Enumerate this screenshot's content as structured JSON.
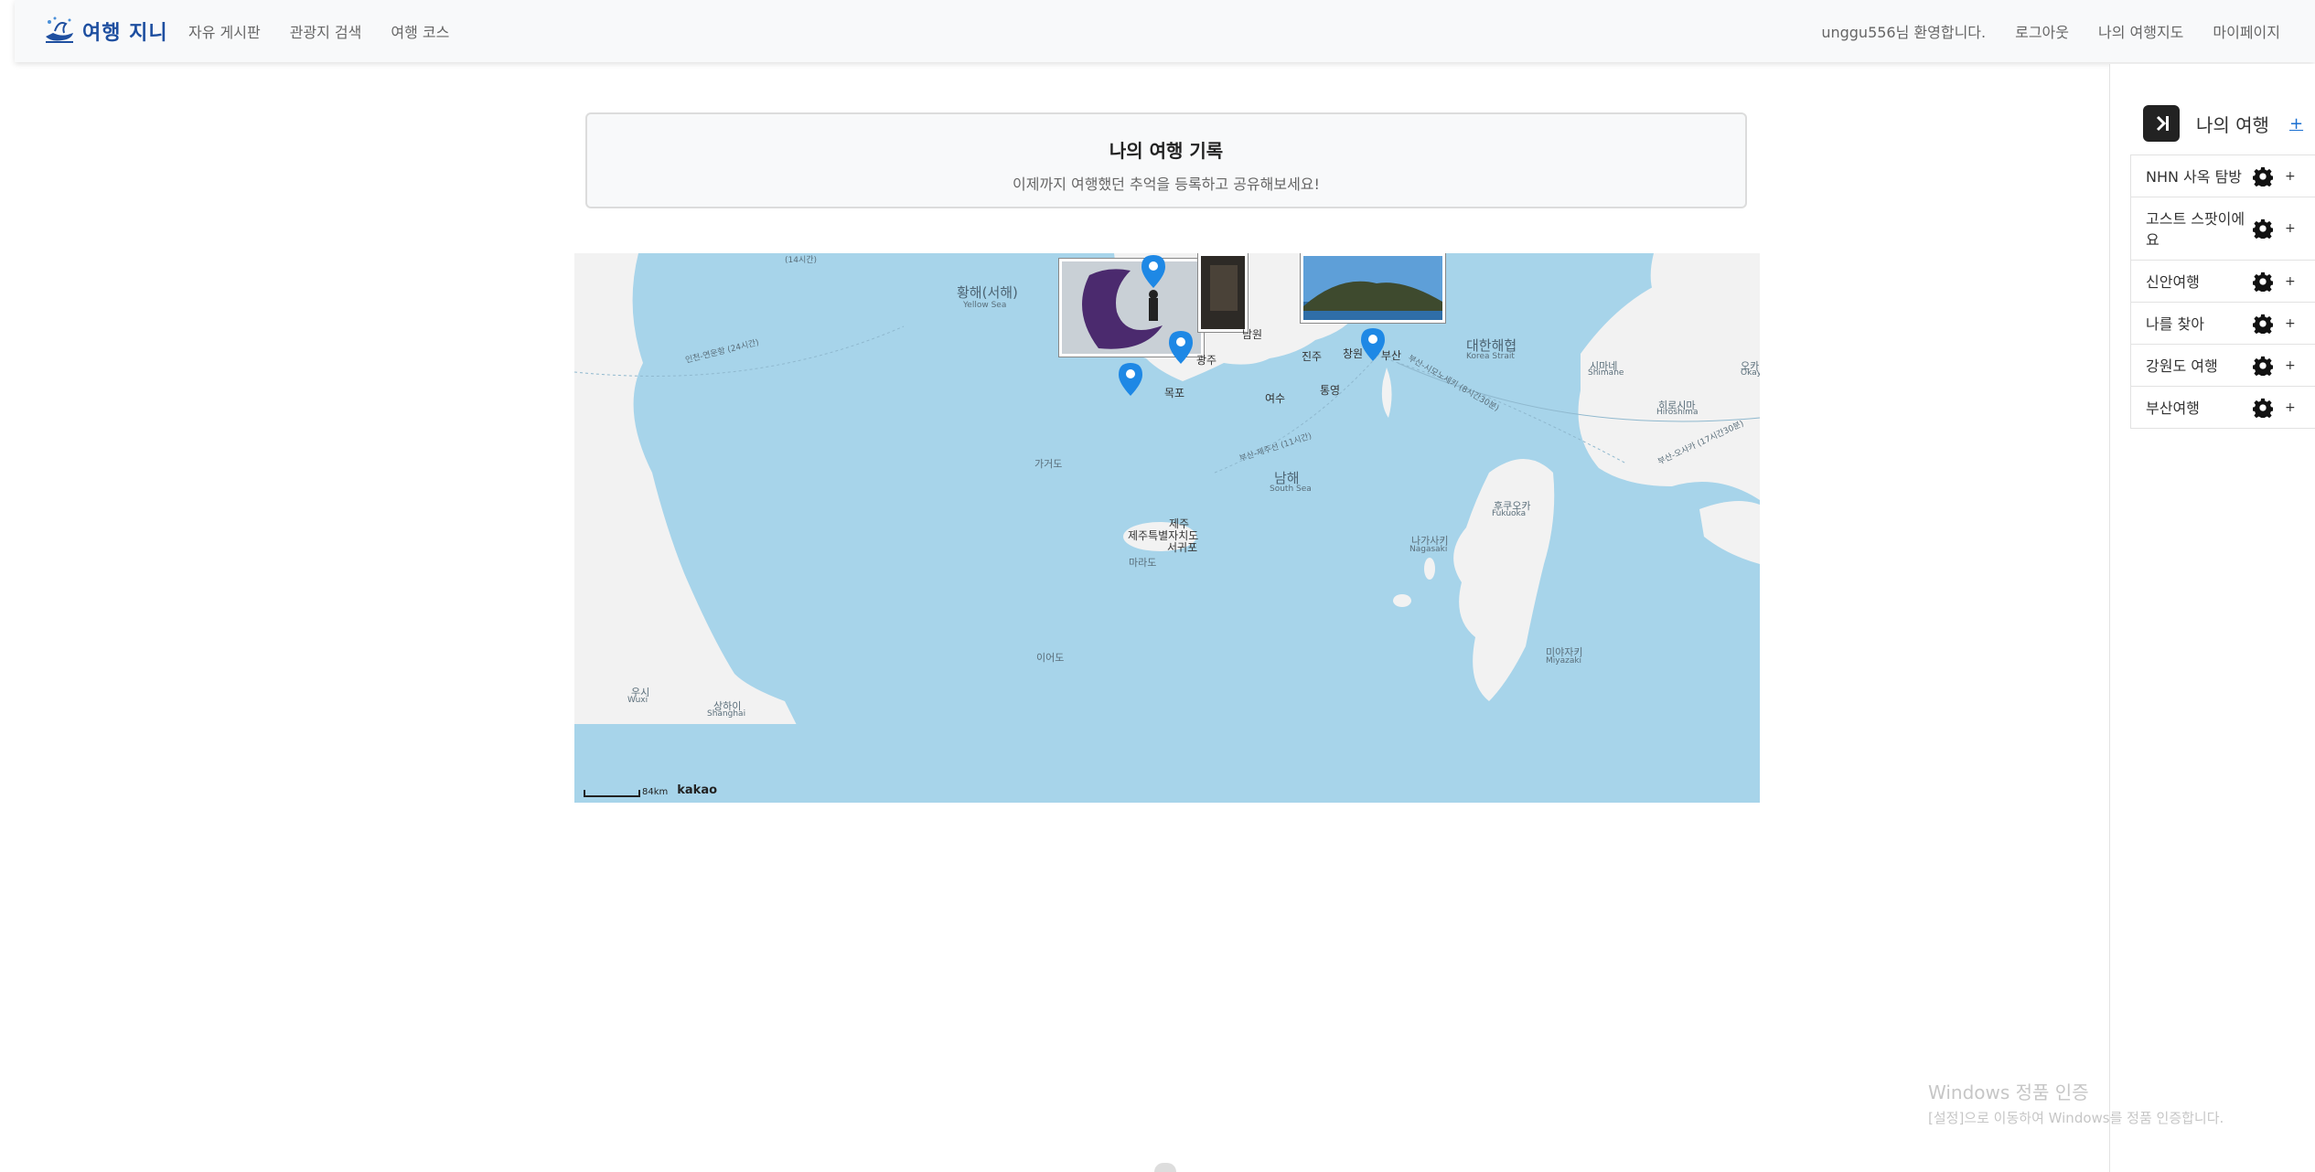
{
  "brand": {
    "logo_text": "여행 지니"
  },
  "nav": {
    "left": [
      "자유 게시판",
      "관광지 검색",
      "여행 코스"
    ],
    "welcome": "unggu556님 환영합니다.",
    "right": [
      "로그아웃",
      "나의 여행지도",
      "마이페이지"
    ]
  },
  "header": {
    "title": "나의 여행 기록",
    "subtitle": "이제까지 여행했던 추억을 등록하고 공유해보세요!"
  },
  "map": {
    "labels": {
      "yellow_sea_ko": "황해(서해)",
      "yellow_sea_en": "Yellow Sea",
      "korea_strait_ko": "대한해협",
      "korea_strait_en": "Korea Strait",
      "south_sea_ko": "남해",
      "south_sea_en": "South Sea",
      "gwangju": "광주",
      "busan": "부산",
      "mokpo": "목포",
      "jinju": "진주",
      "changwon": "창원",
      "yeosu": "여수",
      "tongyeong": "통영",
      "namwon": "남원",
      "gageodo": "가거도",
      "jeju": "제주",
      "jeju_province": "제주특별자치도",
      "seogwipo": "서귀포",
      "marado": "마라도",
      "ieodo": "이어도",
      "fukuoka_ko": "후쿠오카",
      "fukuoka_en": "Fukuoka",
      "nagasaki_ko": "나가사키",
      "nagasaki_en": "Nagasaki",
      "miyazaki_ko": "미야자키",
      "miyazaki_en": "Miyazaki",
      "shimane_ko": "시마네",
      "shimane_en": "Shimane",
      "hiroshima_ko": "히로시마",
      "hiroshima_en": "Hiroshima",
      "okayama_ko": "오카",
      "okayama_en": "Okay",
      "wuxi_ko": "우시",
      "wuxi_en": "Wuxi",
      "shanghai_ko": "상하이",
      "shanghai_en": "Shanghai",
      "route_incheon": "인천-연운항 (24시간)",
      "route_busan_shimonoseki": "부산-시모노세키 (8시간30분)",
      "route_busan_jeju": "부산-제주선 (11시간)",
      "route_busan_osaka": "부산-오사카 (17시간30분)",
      "route_top": "(14시간)"
    },
    "scale_text": "84km",
    "attribution": "kakao",
    "colors": {
      "sea": "#a7d4ea",
      "land": "#f2f2f2",
      "marker": "#1e88e5"
    }
  },
  "sidebar": {
    "title": "나의 여행",
    "add_label": "+",
    "items": [
      {
        "name": "NHN 사옥 탐방",
        "add": "+"
      },
      {
        "name": "고스트 스팟이에요",
        "add": "+"
      },
      {
        "name": "신안여행",
        "add": "+"
      },
      {
        "name": "나를 찾아",
        "add": "+"
      },
      {
        "name": "강원도 여행",
        "add": "+"
      },
      {
        "name": "부산여행",
        "add": "+"
      }
    ]
  },
  "watermark": {
    "line1": "Windows 정품 인증",
    "line2": "[설정]으로 이동하여 Windows를 정품 인증합니다."
  }
}
